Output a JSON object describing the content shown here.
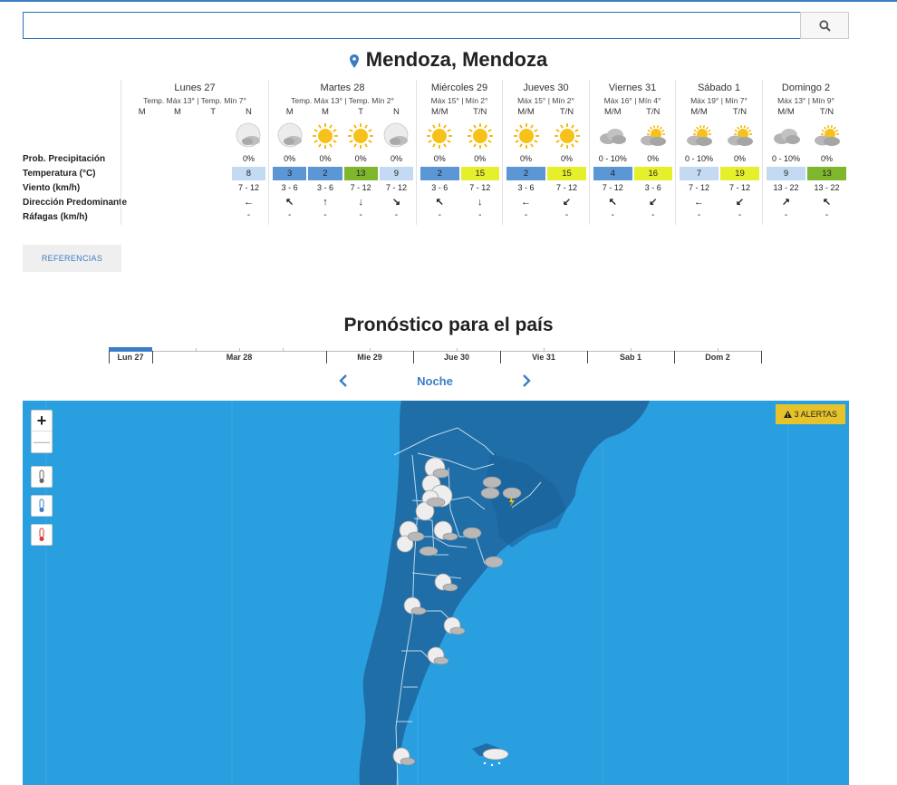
{
  "search": {
    "value": "",
    "placeholder": ""
  },
  "city": "Mendoza, Mendoza",
  "labels": {
    "prob": "Prob. Precipitación",
    "temp": "Temperatura (°C)",
    "wind": "Viento (km/h)",
    "dir": "Dirección Predominante",
    "gust": "Ráfagas (km/h)"
  },
  "days": [
    {
      "name": "Lunes 27",
      "sub": "Temp. Máx 13° | Temp. Mín 7°",
      "periods": [
        "M",
        "M",
        "T",
        "N"
      ],
      "slots": [
        {
          "icon": "",
          "prob": "",
          "temp": "",
          "temp_color": "",
          "wind": "",
          "dir": "",
          "gust": ""
        },
        {
          "icon": "",
          "prob": "",
          "temp": "",
          "temp_color": "",
          "wind": "",
          "dir": "",
          "gust": ""
        },
        {
          "icon": "",
          "prob": "",
          "temp": "",
          "temp_color": "",
          "wind": "",
          "dir": "",
          "gust": ""
        },
        {
          "icon": "moon-cloud-icon",
          "prob": "0%",
          "temp": "8",
          "temp_color": "#c3daf2",
          "wind": "7 - 12",
          "dir": "←",
          "gust": "-"
        }
      ]
    },
    {
      "name": "Martes 28",
      "sub": "Temp. Máx 13° | Temp. Mín 2°",
      "periods": [
        "M",
        "M",
        "T",
        "N"
      ],
      "slots": [
        {
          "icon": "moon-cloud-icon",
          "prob": "0%",
          "temp": "3",
          "temp_color": "#5b97d5",
          "wind": "3 - 6",
          "dir": "↖",
          "gust": "-"
        },
        {
          "icon": "sun-icon",
          "prob": "0%",
          "temp": "2",
          "temp_color": "#5b97d5",
          "wind": "3 - 6",
          "dir": "↑",
          "gust": "-"
        },
        {
          "icon": "sun-icon",
          "prob": "0%",
          "temp": "13",
          "temp_color": "#7fb62c",
          "wind": "7 - 12",
          "dir": "↓",
          "gust": "-"
        },
        {
          "icon": "moon-cloud-icon",
          "prob": "0%",
          "temp": "9",
          "temp_color": "#c3daf2",
          "wind": "7 - 12",
          "dir": "↘",
          "gust": "-"
        }
      ]
    },
    {
      "name": "Miércoles 29",
      "sub": "Máx 15° | Mín 2°",
      "periods": [
        "M/M",
        "T/N"
      ],
      "slots": [
        {
          "icon": "sun-icon",
          "prob": "0%",
          "temp": "2",
          "temp_color": "#5b97d5",
          "wind": "3 - 6",
          "dir": "↖",
          "gust": "-"
        },
        {
          "icon": "sun-icon",
          "prob": "0%",
          "temp": "15",
          "temp_color": "#e6ef2b",
          "wind": "7 - 12",
          "dir": "↓",
          "gust": "-"
        }
      ]
    },
    {
      "name": "Jueves 30",
      "sub": "Máx 15° | Mín 2°",
      "periods": [
        "M/M",
        "T/N"
      ],
      "slots": [
        {
          "icon": "sun-icon",
          "prob": "0%",
          "temp": "2",
          "temp_color": "#5b97d5",
          "wind": "3 - 6",
          "dir": "←",
          "gust": "-"
        },
        {
          "icon": "sun-icon",
          "prob": "0%",
          "temp": "15",
          "temp_color": "#e6ef2b",
          "wind": "7 - 12",
          "dir": "↙",
          "gust": "-"
        }
      ]
    },
    {
      "name": "Viernes 31",
      "sub": "Máx 16° | Mín 4°",
      "periods": [
        "M/M",
        "T/N"
      ],
      "slots": [
        {
          "icon": "cloud-icon",
          "prob": "0 - 10%",
          "temp": "4",
          "temp_color": "#5b97d5",
          "wind": "7 - 12",
          "dir": "↖",
          "gust": "-"
        },
        {
          "icon": "sun-cloud-icon",
          "prob": "0%",
          "temp": "16",
          "temp_color": "#e6ef2b",
          "wind": "3 - 6",
          "dir": "↙",
          "gust": "-"
        }
      ]
    },
    {
      "name": "Sábado 1",
      "sub": "Máx 19° | Mín 7°",
      "periods": [
        "M/M",
        "T/N"
      ],
      "slots": [
        {
          "icon": "sun-cloud-icon",
          "prob": "0 - 10%",
          "temp": "7",
          "temp_color": "#c3daf2",
          "wind": "7 - 12",
          "dir": "←",
          "gust": "-"
        },
        {
          "icon": "sun-cloud-icon",
          "prob": "0%",
          "temp": "19",
          "temp_color": "#e6ef2b",
          "wind": "7 - 12",
          "dir": "↙",
          "gust": "-"
        }
      ]
    },
    {
      "name": "Domingo 2",
      "sub": "Máx 13° | Mín 9°",
      "periods": [
        "M/M",
        "T/N"
      ],
      "slots": [
        {
          "icon": "cloud-icon",
          "prob": "0 - 10%",
          "temp": "9",
          "temp_color": "#c3daf2",
          "wind": "13 - 22",
          "dir": "↗",
          "gust": "-"
        },
        {
          "icon": "sun-cloud-icon",
          "prob": "0%",
          "temp": "13",
          "temp_color": "#7fb62c",
          "wind": "13 - 22",
          "dir": "↖",
          "gust": "-"
        }
      ]
    }
  ],
  "references_label": "REFERENCIAS",
  "country_title": "Pronóstico para el país",
  "timeline": {
    "labels": [
      "Lun 27",
      "Mar 28",
      "Mie 29",
      "Jue 30",
      "Vie 31",
      "Sab 1",
      "Dom 2"
    ],
    "active": "Lun 27"
  },
  "period_nav": {
    "label": "Noche"
  },
  "map": {
    "alerts_label": "3 ALERTAS",
    "zoom_in": "+",
    "zoom_out": "—",
    "ocean_color": "#2a9fe0",
    "land_color": "#1f6ea8"
  }
}
